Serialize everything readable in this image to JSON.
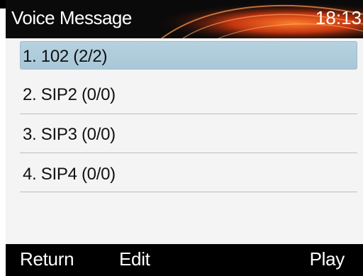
{
  "header": {
    "title": "Voice Message",
    "time": "18:13"
  },
  "list": {
    "items": [
      {
        "label": "1. 102 (2/2)",
        "selected": true
      },
      {
        "label": "2. SIP2 (0/0)",
        "selected": false
      },
      {
        "label": "3. SIP3 (0/0)",
        "selected": false
      },
      {
        "label": "4. SIP4 (0/0)",
        "selected": false
      }
    ]
  },
  "softkeys": {
    "left": "Return",
    "middle": "Edit",
    "right": "Play"
  },
  "colors": {
    "title_bar_bg": "#0a0a0a",
    "title_accent": "#e0531a",
    "selected_bg": "#b2cedd",
    "content_bg": "#f4f4f4",
    "softkey_bar_bg": "#000000"
  }
}
